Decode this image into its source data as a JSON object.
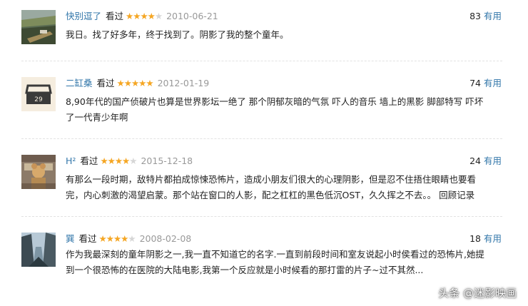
{
  "reviews": [
    {
      "author": "快别逗了",
      "status": "看过",
      "rating": 4,
      "date": "2010-06-21",
      "votes": "83",
      "useful_label": "有用",
      "lines": [
        "我日。找了好多年，终于找到了。阴影了我的整个童年。"
      ]
    },
    {
      "author": "二缸桑",
      "status": "看过",
      "rating": 5,
      "date": "2012-01-19",
      "votes": "74",
      "useful_label": "有用",
      "avatar_text": "29",
      "lines": [
        "8,90年代的国产侦破片也算是世界影坛一绝了 那个阴郁灰暗的气氛 吓人的音乐 墙上的黑影 脚部特写 吓坏",
        "了一代青少年啊"
      ]
    },
    {
      "author": "H²",
      "status": "看过",
      "rating": 4,
      "date": "2015-12-18",
      "votes": "24",
      "useful_label": "有用",
      "lines": [
        "有那么一段时期，敌特片都拍成惊悚恐怖片，造成小朋友们很大的心理阴影，但是忍不住捂住眼睛也要看",
        "完，内心刺激的渴望启蒙。那个站在窗口的人影，配之杠杠的黑色低沉OST，久久挥之不去。。 回顾记录"
      ]
    },
    {
      "author": "巽",
      "status": "看过",
      "rating": 4,
      "date": "2008-02-08",
      "votes": "18",
      "useful_label": "有用",
      "lines": [
        "作为我最深刻的童年阴影之一,我一直不知道它的名字.一直到前段时间和室友说起小时侯看过的恐怖片,她提",
        "到一个很恐怖的在医院的大陆电影,我第一个反应就是小时候看的那打雷的片子~过不其然..."
      ]
    }
  ],
  "watermark": "头条 @迷影映画",
  "colors": {
    "link": "#3377aa",
    "star": "#f5a623",
    "star_off": "#d6d6d6",
    "date": "#999999"
  }
}
